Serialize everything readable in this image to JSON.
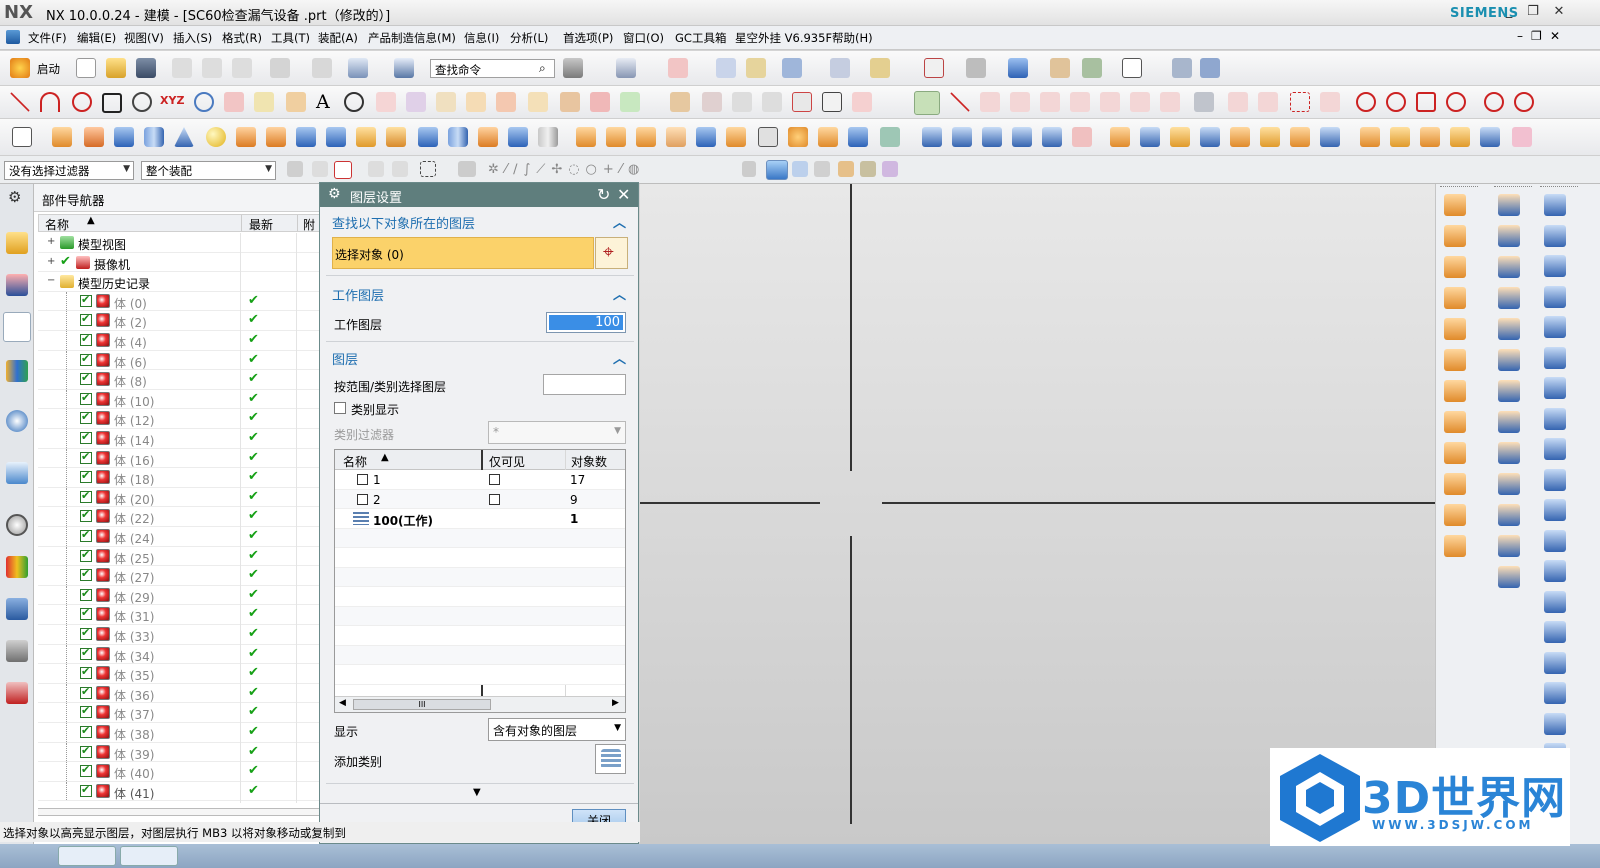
{
  "titlebar": {
    "logo": "NX",
    "title": "NX 10.0.0.24 - 建模 - [SC60检查漏气设备 .prt（修改的）]",
    "brand": "SIEMENS",
    "min": "_",
    "restore": "❐",
    "close": "✕"
  },
  "menubar": {
    "items": [
      "文件(F)",
      "编辑(E)",
      "视图(V)",
      "插入(S)",
      "格式(R)",
      "工具(T)",
      "装配(A)",
      "产品制造信息(M)",
      "信息(I)",
      "分析(L)",
      "首选项(P)",
      "窗口(O)",
      "GC工具箱",
      "星空外挂 V6.935F",
      "帮助(H)"
    ]
  },
  "toolbar": {
    "start_label": "启动",
    "search_placeholder": "查找命令"
  },
  "selection_bar": {
    "filter": "没有选择过滤器",
    "scope": "整个装配"
  },
  "navigator": {
    "title": "部件导航器",
    "columns": {
      "name": "名称",
      "latest": "最新",
      "attached": "附"
    },
    "top_nodes": [
      {
        "label": "模型视图"
      },
      {
        "label": "摄像机"
      },
      {
        "label": "模型历史记录"
      }
    ],
    "bodies": [
      "体 (0)",
      "体 (2)",
      "体 (4)",
      "体 (6)",
      "体 (8)",
      "体 (10)",
      "体 (12)",
      "体 (14)",
      "体 (16)",
      "体 (18)",
      "体 (20)",
      "体 (22)",
      "体 (24)",
      "体 (25)",
      "体 (27)",
      "体 (29)",
      "体 (31)",
      "体 (33)",
      "体 (34)",
      "体 (35)",
      "体 (36)",
      "体 (37)",
      "体 (38)",
      "体 (39)",
      "体 (40)",
      "体 (41)"
    ]
  },
  "dialog": {
    "title": "图层设置",
    "find_section": "查找以下对象所在的图层",
    "select_object": "选择对象 (0)",
    "work_section": "工作图层",
    "work_label": "工作图层",
    "work_value": "100",
    "layers_section": "图层",
    "range_label": "按范围/类别选择图层",
    "category_display": "类别显示",
    "category_filter_label": "类别过滤器",
    "category_filter_value": "*",
    "table": {
      "headers": [
        "名称",
        "仅可见",
        "对象数"
      ],
      "rows": [
        {
          "name": "1",
          "count": "17"
        },
        {
          "name": "2",
          "count": "9"
        },
        {
          "name": "100(工作)",
          "count": "1"
        }
      ]
    },
    "scroll_mid": "III",
    "display_label": "显示",
    "display_value": "含有对象的图层",
    "add_category": "添加类别",
    "close_button": "关闭"
  },
  "statusbar": {
    "text": "选择对象以高亮显示图层，对图层执行 MB3 以将对象移动或复制到"
  },
  "watermark": {
    "brand": "3D世界网",
    "url": "WWW.3DSJW.COM"
  }
}
